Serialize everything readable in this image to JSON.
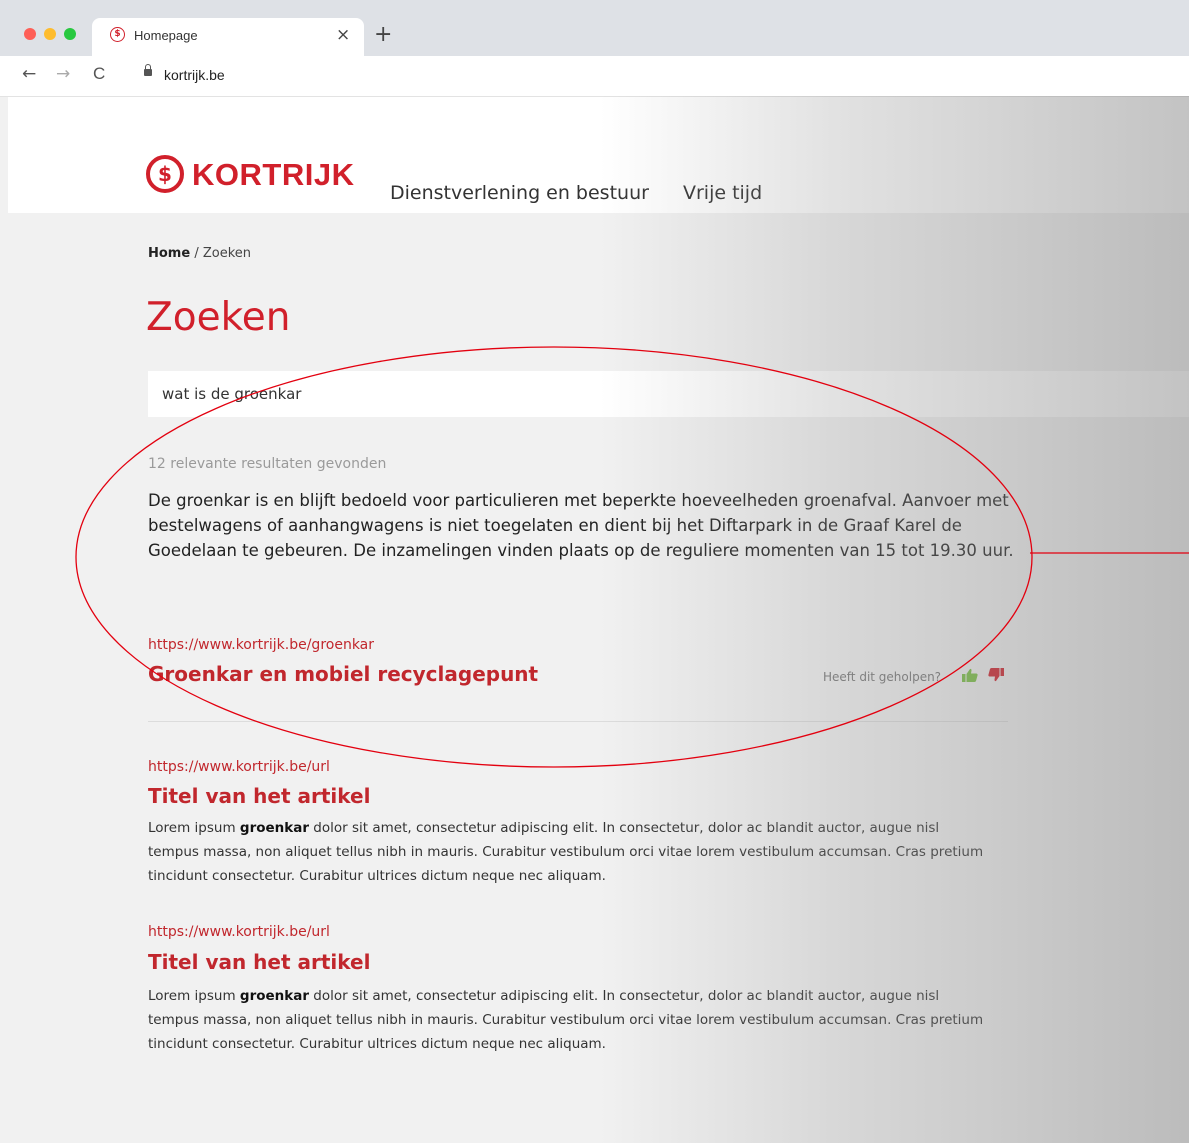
{
  "browser": {
    "tab_title": "Homepage",
    "tab_close": "×",
    "new_tab": "+",
    "back": "←",
    "forward": "→",
    "reload": "C",
    "url": "kortrijk.be",
    "dot_colors": [
      "#fe5f57",
      "#febc2e",
      "#28c840"
    ]
  },
  "header": {
    "logo_text": "KORTRIJK",
    "logo_mark": "$",
    "nav": [
      "Dienstverlening en bestuur",
      "Vrije tijd"
    ]
  },
  "breadcrumb": {
    "home": "Home",
    "separator": " / ",
    "current": "Zoeken"
  },
  "page_title": "Zoeken",
  "search": {
    "value": "wat is de groenkar"
  },
  "results": {
    "count_text": "12 relevante resultaten gevonden",
    "answer": "De groenkar is en blijft bedoeld voor particulieren met beperkte hoeveelheden groenafval. Aanvoer met bestelwagens of aanhangwagens is niet toegelaten en dient bij het Diftarpark in de Graaf Karel de Goedelaan te gebeuren. De inzamelingen vinden plaats op de reguliere momenten van 15 tot 19.30 uur.",
    "featured": {
      "url": "https://www.kortrijk.be/groenkar",
      "title": "Groenkar en mobiel recyclagepunt",
      "helped_text": "Heeft dit geholpen?"
    },
    "items": [
      {
        "url": "https://www.kortrijk.be/url",
        "title": "Titel van het artikel",
        "snippet_before": "Lorem ipsum ",
        "snippet_bold": "groenkar",
        "snippet_after": " dolor sit amet, consectetur adipiscing elit. In consectetur, dolor ac blandit auctor, augue nisl tempus massa, non aliquet tellus nibh in mauris. Curabitur vestibulum orci vitae lorem vestibulum accumsan. Cras pretium tincidunt consectetur. Curabitur ultrices dictum neque nec aliquam."
      },
      {
        "url": "https://www.kortrijk.be/url",
        "title": "Titel van het artikel",
        "snippet_before": "Lorem ipsum ",
        "snippet_bold": "groenkar",
        "snippet_after": " dolor sit amet, consectetur adipiscing elit. In consectetur, dolor ac blandit auctor, augue nisl tempus massa, non aliquet tellus nibh in mauris. Curabitur vestibulum orci vitae lorem vestibulum accumsan. Cras pretium tincidunt consectetur. Curabitur ultrices dictum neque nec aliquam."
      }
    ]
  },
  "colors": {
    "brand": "#d1202b",
    "thumb_up": "#7ac143",
    "thumb_down": "#d1202b",
    "annotation": "#e3000f"
  }
}
